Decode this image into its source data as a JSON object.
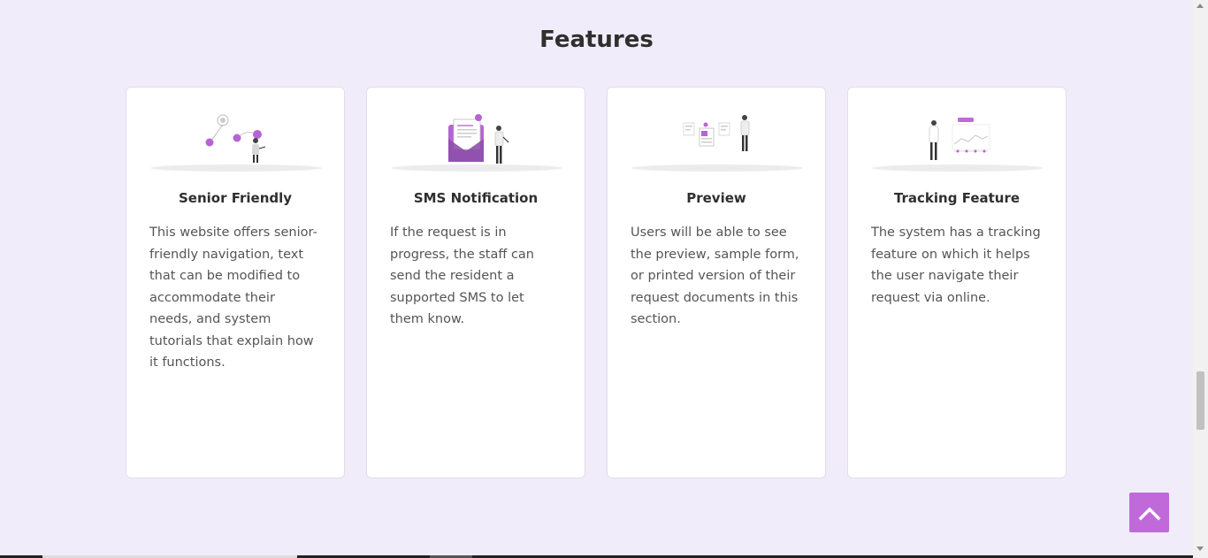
{
  "section": {
    "title": "Features"
  },
  "cards": [
    {
      "title": "Senior Friendly",
      "text": "This website offers senior-friendly navigation, text that can be modified to accommodate their needs, and system tutorials that explain how it functions.",
      "icon": "senior-friendly-illustration-icon"
    },
    {
      "title": "SMS Notification",
      "text": "If the request is in progress, the staff can send the resident a supported SMS to let them know.",
      "icon": "sms-notification-illustration-icon"
    },
    {
      "title": "Preview",
      "text": "Users will be able to see the preview, sample form, or printed version of their request documents in this section.",
      "icon": "preview-illustration-icon"
    },
    {
      "title": "Tracking Feature",
      "text": "The system has a tracking feature on which it helps the user navigate their request via online.",
      "icon": "tracking-illustration-icon"
    }
  ],
  "back_to_top": {
    "icon": "chevron-up-icon"
  },
  "colors": {
    "background": "#f1ecfa",
    "accent": "#c06ad9",
    "card": "#ffffff"
  }
}
